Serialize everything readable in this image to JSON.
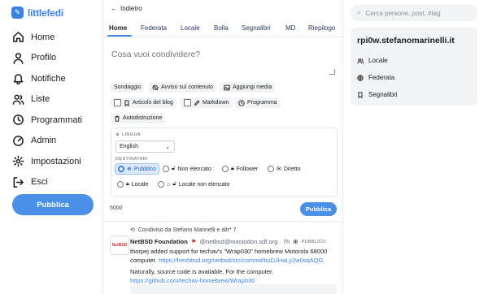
{
  "brand": {
    "name": "littlefedi"
  },
  "nav": [
    {
      "label": "Home",
      "icon": "home-icon"
    },
    {
      "label": "Profilo",
      "icon": "user-icon"
    },
    {
      "label": "Notifiche",
      "icon": "bell-icon"
    },
    {
      "label": "Liste",
      "icon": "users-icon"
    },
    {
      "label": "Programmati",
      "icon": "clock-icon"
    },
    {
      "label": "Admin",
      "icon": "gauge-icon"
    },
    {
      "label": "Impostazioni",
      "icon": "gear-icon"
    },
    {
      "label": "Esci",
      "icon": "logout-icon"
    }
  ],
  "sidebar_publish": "Pubblica",
  "back_label": "Indietro",
  "tabs": [
    "Home",
    "Federata",
    "Locale",
    "Bolla",
    "Segnalibri",
    "MD",
    "Riepilogo"
  ],
  "compose": {
    "placeholder": "Cosa vuoi condividere?"
  },
  "compose_options": {
    "sondaggio": "Sondaggio",
    "avviso": "Avviso sul contenuto",
    "aggiungi_media": "Aggiungi media",
    "articolo": "Articolo del blog",
    "markdown": "Markdown",
    "programma": "Programma",
    "autodistruzione": "Autodistruzione"
  },
  "language": {
    "label": "LINGUA",
    "value": "English"
  },
  "recipients": {
    "label": "DESTINATARI",
    "options": [
      "Pubblico",
      "Non elencato",
      "Follower",
      "Diretto",
      "Locale",
      "Locale non elencato"
    ],
    "selected": "Pubblico"
  },
  "char_count": "5000",
  "publish_label": "Pubblica",
  "post": {
    "shared_by": "Condiviso da  Stefano Marinelli  e altr* 7",
    "avatar_text": "NetBSD",
    "author": "NetBSD Foundation",
    "handle": "@netbsd@mastodon.sdf.org · 7h",
    "visibility": "PUBBLICO",
    "text1": "thorpej added support for techav's \"Wrap030\" homebrew Motorola 68000 computer.",
    "link1": "https://freshbsd.org/netbsd/src/commit/buDJHaLy2w0sqAQG",
    "text2": "Naturally, source code is available. For the computer.",
    "link2": "https://github.com/techav-homebrew/Wrap030"
  },
  "search": {
    "placeholder": "Cerca persone, post, #tag"
  },
  "profile": {
    "account": "rpi0w.stefanomarinelli.it",
    "links": [
      {
        "label": "Locale",
        "icon": "users-icon"
      },
      {
        "label": "Federata",
        "icon": "globe-icon"
      },
      {
        "label": "Segnalibri",
        "icon": "bookmark-icon"
      }
    ]
  },
  "colors": {
    "accent": "#3c82e6",
    "button": "#4a90e8",
    "card_bg": "#f2f3f5"
  }
}
